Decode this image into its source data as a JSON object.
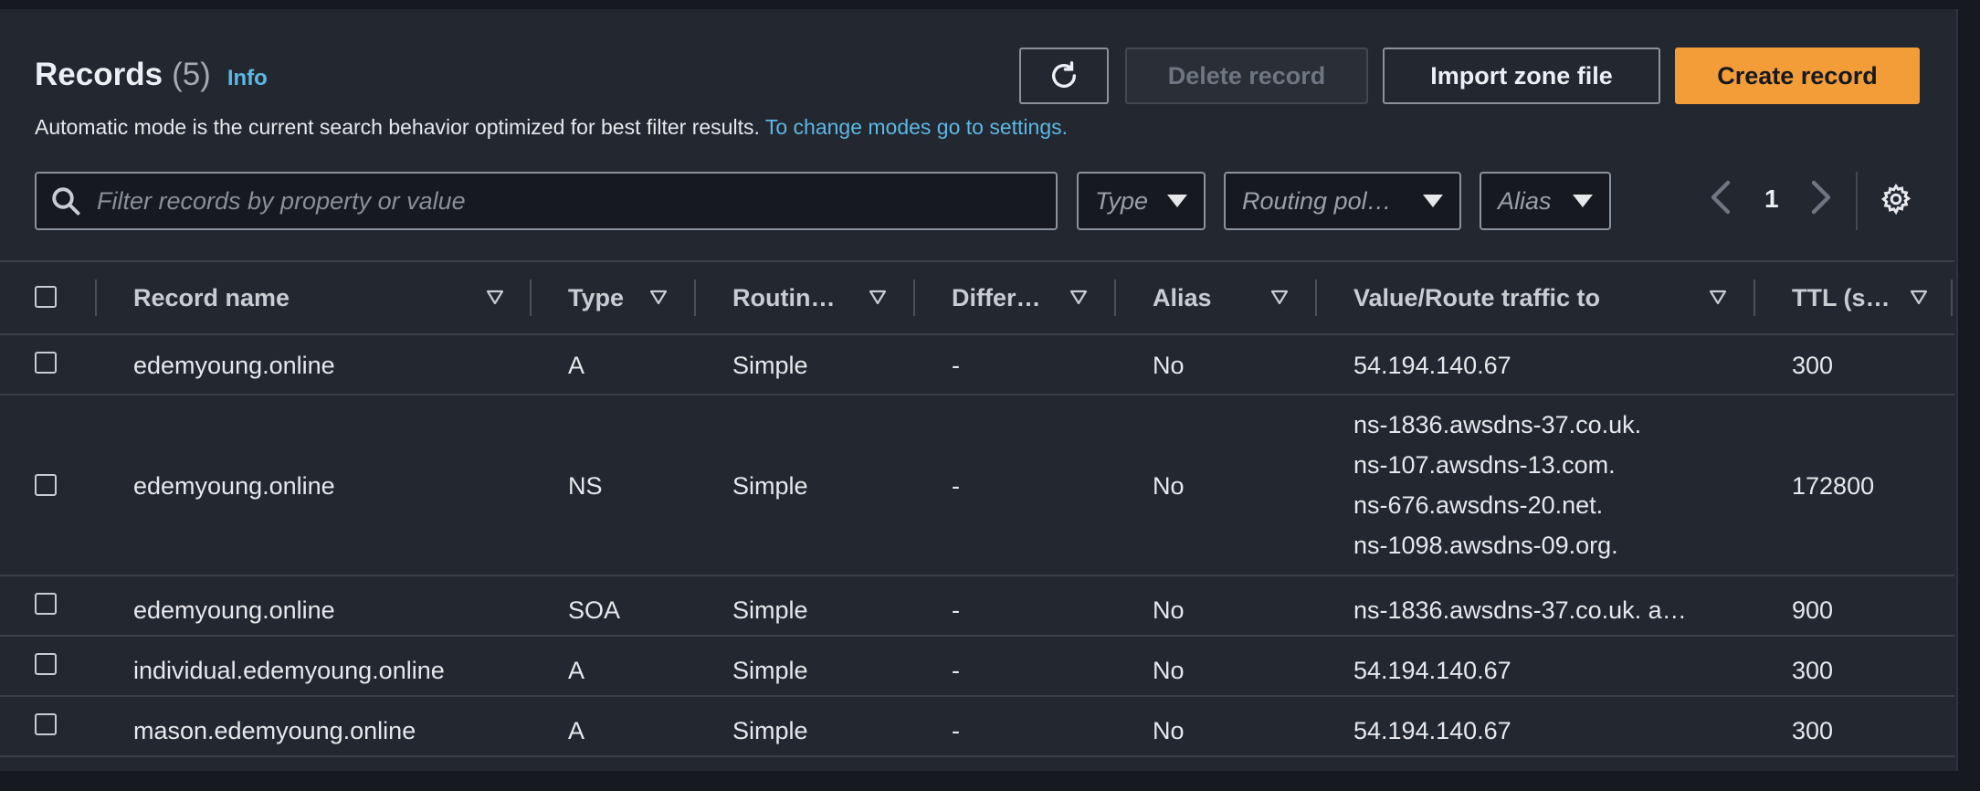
{
  "header": {
    "title": "Records",
    "count": "(5)",
    "info_label": "Info",
    "description": "Automatic mode is the current search behavior optimized for best filter results.",
    "settings_link": "To change modes go to settings."
  },
  "actions": {
    "delete_label": "Delete record",
    "import_label": "Import zone file",
    "create_label": "Create record"
  },
  "filters": {
    "search_placeholder": "Filter records by property or value",
    "type_label": "Type",
    "routing_label": "Routing pol…",
    "alias_label": "Alias"
  },
  "pagination": {
    "page": "1"
  },
  "table": {
    "columns": [
      "Record name",
      "Type",
      "Routin…",
      "Differ…",
      "Alias",
      "Value/Route traffic to",
      "TTL (s…"
    ],
    "rows": [
      {
        "name": "edemyoung.online",
        "type": "A",
        "routing": "Simple",
        "differ": "-",
        "alias": "No",
        "values": [
          "54.194.140.67"
        ],
        "ttl": "300"
      },
      {
        "name": "edemyoung.online",
        "type": "NS",
        "routing": "Simple",
        "differ": "-",
        "alias": "No",
        "values": [
          "ns-1836.awsdns-37.co.uk.",
          "ns-107.awsdns-13.com.",
          "ns-676.awsdns-20.net.",
          "ns-1098.awsdns-09.org."
        ],
        "ttl": "172800"
      },
      {
        "name": "edemyoung.online",
        "type": "SOA",
        "routing": "Simple",
        "differ": "-",
        "alias": "No",
        "values": [
          "ns-1836.awsdns-37.co.uk. a…"
        ],
        "ttl": "900"
      },
      {
        "name": "individual.edemyoung.online",
        "type": "A",
        "routing": "Simple",
        "differ": "-",
        "alias": "No",
        "values": [
          "54.194.140.67"
        ],
        "ttl": "300"
      },
      {
        "name": "mason.edemyoung.online",
        "type": "A",
        "routing": "Simple",
        "differ": "-",
        "alias": "No",
        "values": [
          "54.194.140.67"
        ],
        "ttl": "300"
      }
    ]
  },
  "colors": {
    "accent": "#f29d38",
    "link": "#5cb8e4",
    "background": "#232730"
  }
}
